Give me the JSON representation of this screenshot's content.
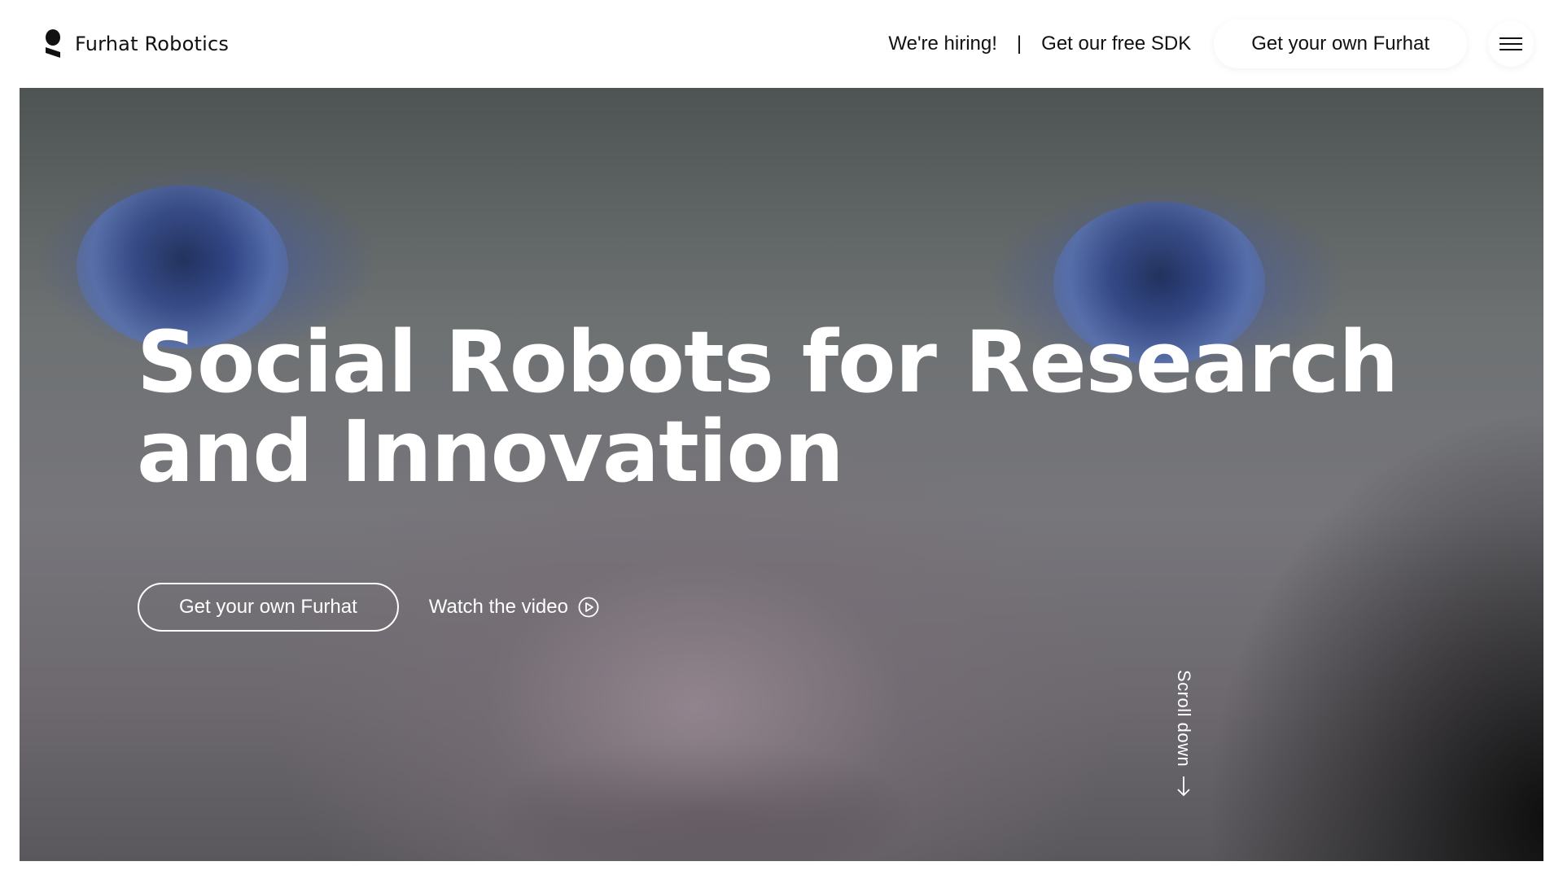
{
  "header": {
    "logo_text": "Furhat Robotics",
    "logo_icon": "furhat-logo-mark",
    "nav": {
      "hiring": "We're hiring!",
      "separator": "|",
      "sdk": "Get our free SDK",
      "cta": "Get your own Furhat",
      "menu_icon": "hamburger-menu-icon"
    }
  },
  "hero": {
    "title": "Social Robots for Research and Innovation",
    "cta": "Get your own Furhat",
    "watch": "Watch the video",
    "watch_icon": "play-circle-icon",
    "scroll": "Scroll down",
    "scroll_icon": "arrow-down-icon"
  },
  "colors": {
    "text_dark": "#111111",
    "text_on_hero": "#ffffff",
    "background": "#ffffff"
  }
}
